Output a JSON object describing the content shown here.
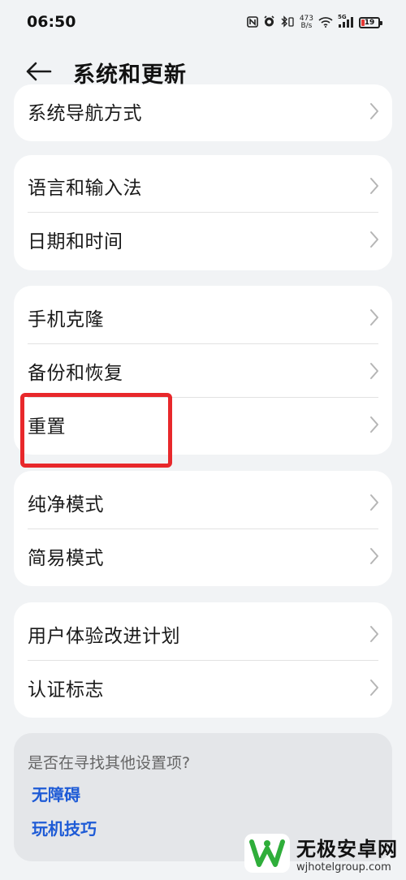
{
  "status_bar": {
    "time": "06:50",
    "net_speed_value": "473",
    "net_speed_unit": "B/s",
    "signal_tag": "5G",
    "battery_level": "19"
  },
  "header": {
    "title": "系统和更新"
  },
  "groups": [
    {
      "items": [
        {
          "label": "系统导航方式"
        }
      ]
    },
    {
      "items": [
        {
          "label": "语言和输入法"
        },
        {
          "label": "日期和时间"
        }
      ]
    },
    {
      "items": [
        {
          "label": "手机克隆"
        },
        {
          "label": "备份和恢复"
        },
        {
          "label": "重置"
        }
      ]
    },
    {
      "items": [
        {
          "label": "纯净模式"
        },
        {
          "label": "简易模式"
        }
      ]
    },
    {
      "items": [
        {
          "label": "用户体验改进计划"
        },
        {
          "label": "认证标志"
        }
      ]
    }
  ],
  "suggestions": {
    "question": "是否在寻找其他设置项?",
    "links": [
      {
        "label": "无障碍"
      },
      {
        "label": "玩机技巧"
      }
    ]
  },
  "watermark": {
    "name": "无极安卓网",
    "url": "wjhotelgroup.com"
  },
  "colors": {
    "background": "#f1f3f5",
    "card": "#ffffff",
    "link": "#1e5bd6",
    "highlight": "#e8282b",
    "battery_low": "#e53935"
  }
}
